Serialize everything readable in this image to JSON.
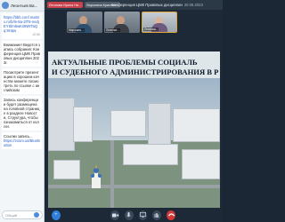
{
  "chat": {
    "header_name": "Леонтьев Ва...",
    "messages": [
      {
        "text": "https://bbb.conf.maitrix.ru/b/le-8a-2lT8-nedjEYSlm6wKs9WtTaQq:9Hqw",
        "is_link": true,
        "time": "12:55"
      },
      {
        "text": "Внимание! Ведется запись собрания: Конференция ЦМК Правовых дисциплин 2023г.",
        "is_link": false,
        "time": ""
      },
      {
        "text": "Посмотрите презентацию в хорошем качестве можете посмотреть по ссылке с английским",
        "is_link": false,
        "time": ""
      },
      {
        "text": "Запись конференции будет размещена на головной странице в разделе Новости, Структура, чтобы ознакомиться от коллег.",
        "is_link": false,
        "time": ""
      },
      {
        "text": "Ссылки запись...",
        "is_link": false,
        "time": ""
      },
      {
        "text": "https://zoom.us/BlueButton",
        "is_link": true,
        "time": ""
      }
    ],
    "input_placeholder": "Общий"
  },
  "meeting": {
    "tags": [
      "Леонова Ирина Ни...",
      "Воронина Кристин..."
    ],
    "title": "Конференция ЦМК Правовых дисциплин",
    "date": "20.06.2023",
    "participants": [
      {
        "name": "Мирошни...",
        "shirt": "#2f4f6f"
      },
      {
        "name": "Леонтье...",
        "shirt": "#3a3f45"
      },
      {
        "name": "Леонова...",
        "shirt": "#6e5a7e"
      }
    ],
    "slide_title_line1": "АКТУАЛЬНЫЕ ПРОБЛЕМЫ СОЦИАЛЬ",
    "slide_title_line2": "И СУДЕБНОГО АДМИНИСТРИРОВАНИЯ В Р"
  },
  "controls": {
    "icons": [
      "plus-icon",
      "camera-icon",
      "microphone-icon",
      "screen-share-icon",
      "hand-icon",
      "hangup-icon"
    ]
  },
  "colors": {
    "accent": "#2e7fd9",
    "hangup": "#d13a3a",
    "tag_red": "#c9414b"
  }
}
